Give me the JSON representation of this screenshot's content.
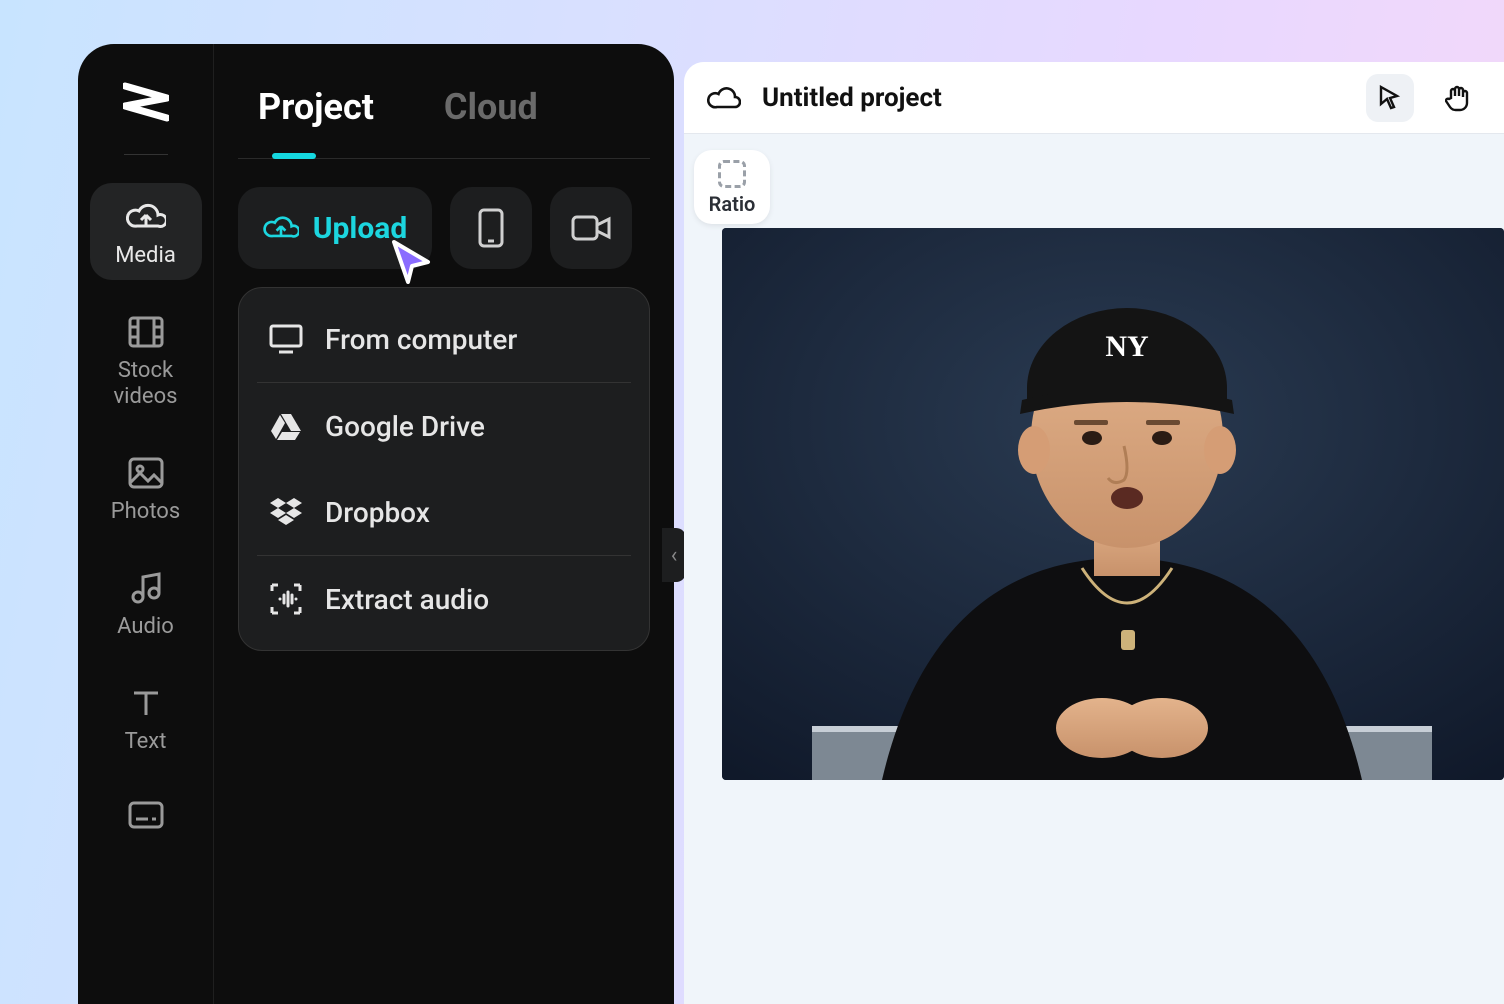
{
  "colors": {
    "accent": "#1cd6df",
    "cursor": "#8a6cff"
  },
  "rail": [
    {
      "id": "media",
      "label": "Media",
      "icon": "cloud-up-icon",
      "active": true
    },
    {
      "id": "stock-videos",
      "label": "Stock\nvideos",
      "icon": "film-icon",
      "active": false
    },
    {
      "id": "photos",
      "label": "Photos",
      "icon": "image-icon",
      "active": false
    },
    {
      "id": "audio",
      "label": "Audio",
      "icon": "music-icon",
      "active": false
    },
    {
      "id": "text",
      "label": "Text",
      "icon": "text-icon",
      "active": false
    },
    {
      "id": "captions",
      "label": "",
      "icon": "caption-icon",
      "active": false
    }
  ],
  "tabs": {
    "project": "Project",
    "cloud": "Cloud",
    "active": "project"
  },
  "actions": {
    "upload_label": "Upload"
  },
  "upload_menu": [
    {
      "id": "from-computer",
      "label": "From computer",
      "icon": "monitor-icon"
    },
    {
      "id": "google-drive",
      "label": "Google Drive",
      "icon": "gdrive-icon"
    },
    {
      "id": "dropbox",
      "label": "Dropbox",
      "icon": "dropbox-icon"
    },
    {
      "id": "extract-audio",
      "label": "Extract audio",
      "icon": "extract-icon"
    }
  ],
  "canvas": {
    "project_title": "Untitled project",
    "ratio_label": "Ratio"
  }
}
